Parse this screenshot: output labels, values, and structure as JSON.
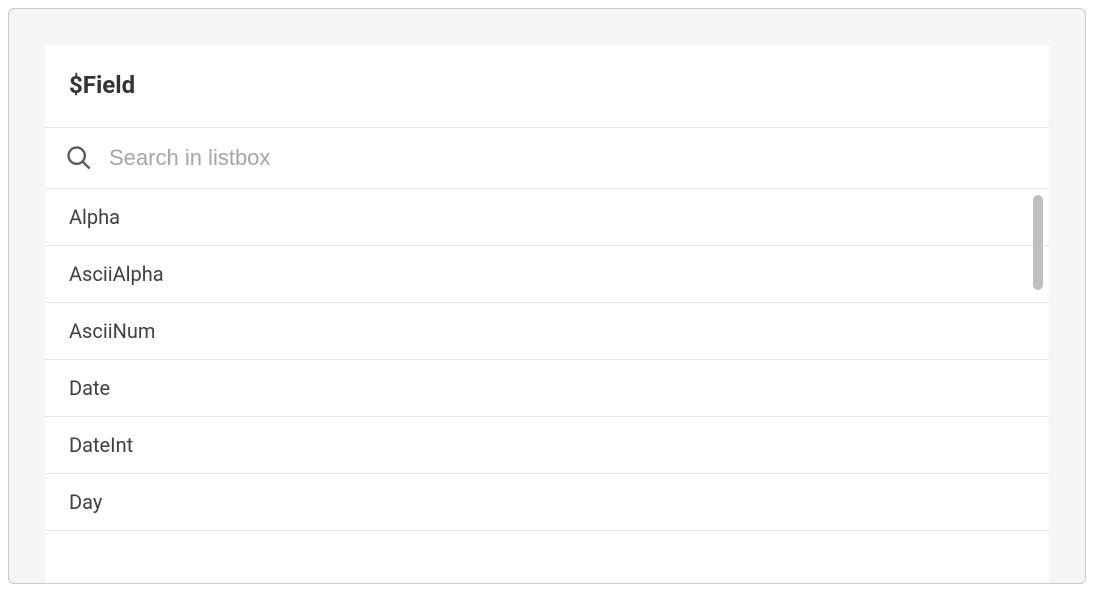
{
  "header": {
    "title": "$Field"
  },
  "search": {
    "placeholder": "Search in listbox",
    "value": ""
  },
  "items": [
    {
      "label": "Alpha"
    },
    {
      "label": "AsciiAlpha"
    },
    {
      "label": "AsciiNum"
    },
    {
      "label": "Date"
    },
    {
      "label": "DateInt"
    },
    {
      "label": "Day"
    }
  ]
}
